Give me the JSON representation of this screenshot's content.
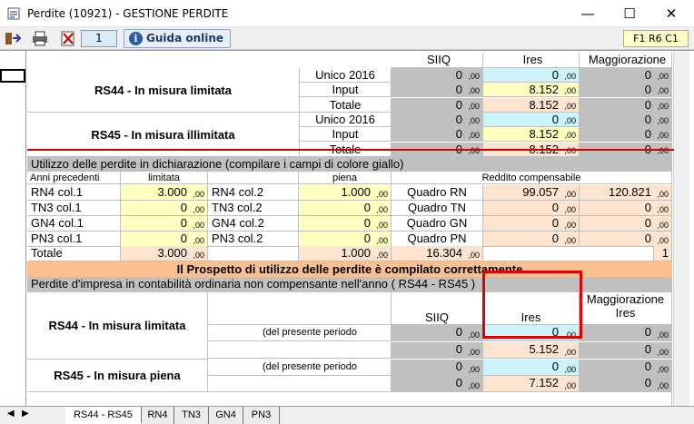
{
  "window": {
    "title": "Perdite (10921) - GESTIONE PERDITE",
    "minimize": "—",
    "maximize": "☐",
    "close": "✕"
  },
  "toolbar": {
    "page_number": "1",
    "guida_label": "Guida online",
    "cell_ref": "F1 R6 C1"
  },
  "headers": {
    "siiq": "SIIQ",
    "ires": "Ires",
    "maggiorazione": "Maggiorazione"
  },
  "rs44": {
    "title": "RS44 - In misura limitata",
    "rows": [
      {
        "label": "Unico 2016",
        "siiq": "0",
        "ires": "0",
        "magg": "0"
      },
      {
        "label": "Input",
        "siiq": "0",
        "ires": "8.152",
        "magg": "0"
      },
      {
        "label": "Totale",
        "siiq": "0",
        "ires": "8.152",
        "magg": "0"
      }
    ]
  },
  "rs45": {
    "title": "RS45 - In misura illimitata",
    "rows": [
      {
        "label": "Unico 2016",
        "siiq": "0",
        "ires": "0",
        "magg": "0"
      },
      {
        "label": "Input",
        "siiq": "0",
        "ires": "8.152",
        "magg": "0"
      },
      {
        "label": "Totale",
        "siiq": "0",
        "ires": "8.152",
        "magg": "0"
      }
    ]
  },
  "utilizzo": {
    "header": "Utilizzo delle perdite in dichiarazione (compilare i campi di colore giallo)",
    "col_anni": "Anni precedenti",
    "col_limitata": "limitata",
    "col_piena": "piena",
    "col_reddito": "Reddito compensabile",
    "rows": [
      {
        "label": "RN4 col.1",
        "lim": "3.000",
        "label2": "RN4 col.2",
        "piena": "1.000",
        "quadro": "Quadro RN",
        "r1": "99.057",
        "r2": "120.821"
      },
      {
        "label": "TN3 col.1",
        "lim": "0",
        "label2": "TN3 col.2",
        "piena": "0",
        "quadro": "Quadro TN",
        "r1": "0",
        "r2": "0"
      },
      {
        "label": "GN4 col.1",
        "lim": "0",
        "label2": "GN4 col.2",
        "piena": "0",
        "quadro": "Quadro GN",
        "r1": "0",
        "r2": "0"
      },
      {
        "label": "PN3 col.1",
        "lim": "0",
        "label2": "PN3 col.2",
        "piena": "0",
        "quadro": "Quadro PN",
        "r1": "0",
        "r2": "0"
      }
    ],
    "totale_label": "Totale",
    "tot_lim": "3.000",
    "tot_piena": "1.000",
    "tot_quadro": "16.304",
    "tot_last": "1"
  },
  "status_message": "Il Prospetto di utilizzo delle perdite è compilato correttamente",
  "perdite_header": "Perdite d'impresa in contabilità ordinaria non compensante nell'anno ( RS44 - RS45 )",
  "bottom": {
    "siiq": "SIIQ",
    "ires": "Ires",
    "magg_line1": "Maggiorazione",
    "magg_line2": "Ires",
    "rs44_title": "RS44 - In misura limitata",
    "rs45_title": "RS45 - In misura piena",
    "periodo_label": "(del presente periodo",
    "rows": [
      {
        "siiq": "0",
        "ires": "0",
        "magg": "0"
      },
      {
        "siiq": "0",
        "ires": "5.152",
        "magg": "0"
      },
      {
        "siiq": "0",
        "ires": "0",
        "magg": "0"
      },
      {
        "siiq": "0",
        "ires": "7.152",
        "magg": "0"
      }
    ]
  },
  "decimals": ",00",
  "tabs": [
    "RS44 - RS45",
    "RN4",
    "TN3",
    "GN4",
    "PN3"
  ]
}
